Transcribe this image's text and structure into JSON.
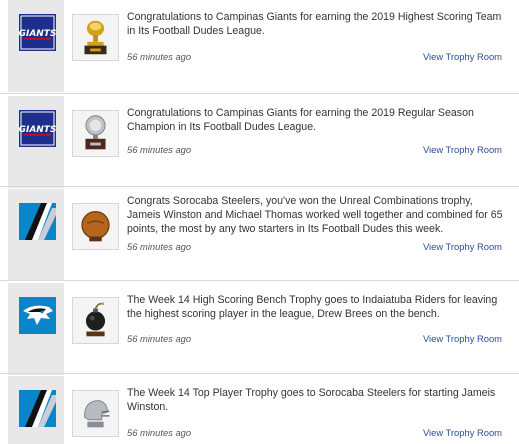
{
  "feed": {
    "items": [
      {
        "team_icon": "giants-logo",
        "trophy_icon": "gold-trophy-icon",
        "message": "Congratulations to Campinas Giants for earning the 2019 Highest Scoring Team in Its Football Dudes League.",
        "time": "56 minutes ago",
        "link": "View Trophy Room"
      },
      {
        "team_icon": "giants-logo",
        "trophy_icon": "silver-trophy-icon",
        "message": "Congratulations to Campinas Giants for earning the 2019 Regular Season Champion in Its Football Dudes League.",
        "time": "56 minutes ago",
        "link": "View Trophy Room"
      },
      {
        "team_icon": "panthers-stripe-logo",
        "trophy_icon": "football-trophy-icon",
        "message": "Congrats Sorocaba Steelers, you've won the Unreal Combinations trophy, Jameis Winston and Michael Thomas worked well together and combined for 65 points, the most by any two starters in Its Football Dudes this week.",
        "time": "56 minutes ago",
        "link": "View Trophy Room"
      },
      {
        "team_icon": "panthers-head-logo",
        "trophy_icon": "bomb-trophy-icon",
        "message": "The Week 14 High Scoring Bench Trophy goes to Indaiatuba Riders for leaving the highest scoring player in the league, Drew Brees on the bench.",
        "time": "56 minutes ago",
        "link": "View Trophy Room"
      },
      {
        "team_icon": "panthers-stripe-logo",
        "trophy_icon": "helmet-trophy-icon",
        "message": "The Week 14 Top Player Trophy goes to Sorocaba Steelers for starting Jameis Winston.",
        "time": "56 minutes ago",
        "link": "View Trophy Room"
      }
    ],
    "logo_text": "GIANTS"
  },
  "colors": {
    "giants_blue": "#1c2f8c",
    "giants_red": "#c8102e",
    "panthers_blue": "#0a85ca",
    "panthers_black": "#111111",
    "link_blue": "#2a4f94"
  }
}
